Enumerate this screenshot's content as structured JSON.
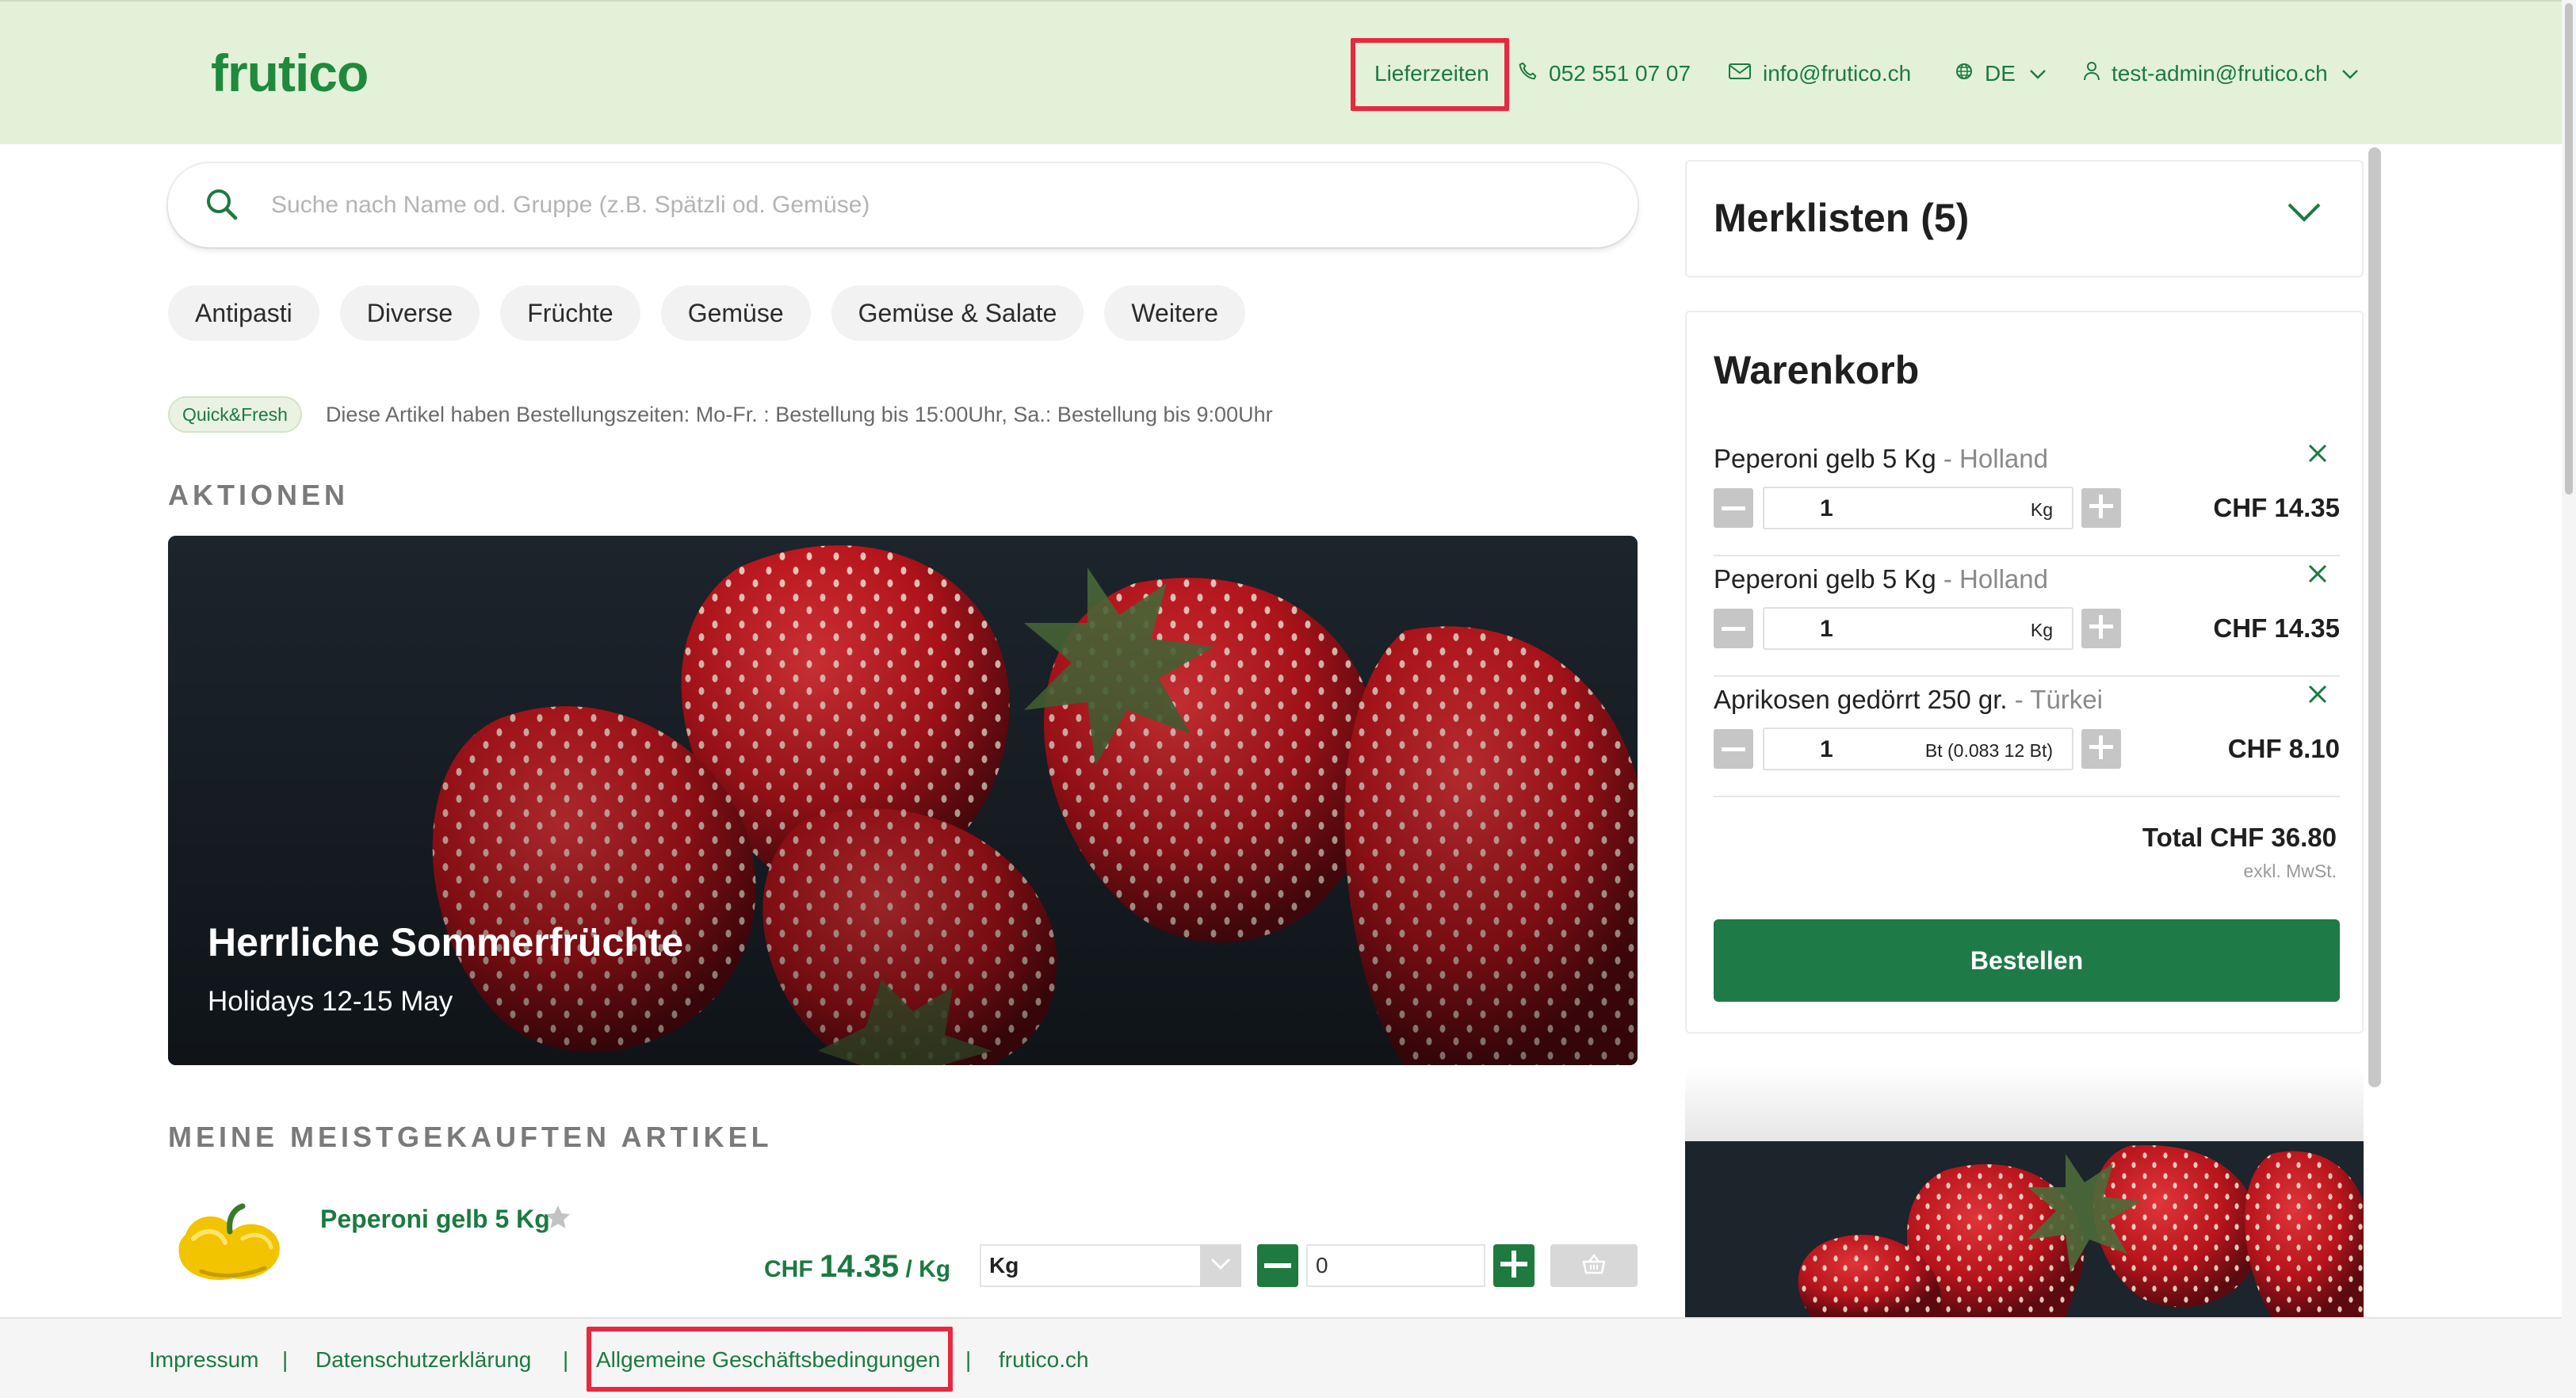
{
  "header": {
    "logo": "frutico",
    "delivery_times": "Lieferzeiten",
    "phone": "052 551 07 07",
    "email": "info@frutico.ch",
    "language": "DE",
    "user": "test-admin@frutico.ch",
    "bg_color": "#e3f1d8",
    "accent_color": "#1b7a40"
  },
  "search": {
    "placeholder": "Suche nach Name od. Gruppe (z.B. Spätzli od. Gemüse)"
  },
  "categories": [
    "Antipasti",
    "Diverse",
    "Früchte",
    "Gemüse",
    "Gemüse & Salate",
    "Weitere"
  ],
  "quickfresh": {
    "badge": "Quick&Fresh",
    "text": "Diese Artikel haben Bestellungszeiten: Mo-Fr. : Bestellung bis 15:00Uhr, Sa.: Bestellung bis 9:00Uhr"
  },
  "actions": {
    "heading": "AKTIONEN",
    "banner_title": "Herrliche Sommerfrüchte",
    "banner_subtitle": "Holidays 12-15 May"
  },
  "most_bought": {
    "heading": "MEINE MEISTGEKAUFTEN ARTIKEL",
    "product": {
      "name": "Peperoni gelb 5 Kg",
      "currency": "CHF",
      "price": "14.35",
      "per_unit": "/ Kg",
      "unit": "Kg",
      "quantity": "0"
    }
  },
  "watchlists": {
    "title": "Merklisten (5)"
  },
  "cart": {
    "title": "Warenkorb",
    "items": [
      {
        "name": "Peperoni gelb 5 Kg",
        "origin": "- Holland",
        "qty": "1",
        "unit": "Kg",
        "price": "CHF 14.35"
      },
      {
        "name": "Peperoni gelb 5 Kg",
        "origin": "- Holland",
        "qty": "1",
        "unit": "Kg",
        "price": "CHF 14.35"
      },
      {
        "name": "Aprikosen gedörrt 250 gr.",
        "origin": "- Türkei",
        "qty": "1",
        "unit": "Bt (0.083 12 Bt)",
        "price": "CHF 8.10"
      }
    ],
    "total": "Total CHF 36.80",
    "vat_note": "exkl. MwSt.",
    "order_button": "Bestellen"
  },
  "footer": {
    "links": [
      "Impressum",
      "Datenschutzerklärung",
      "Allgemeine Geschäftsbedingungen",
      "frutico.ch"
    ],
    "separator": "|"
  },
  "icons": [
    "search-icon",
    "phone-icon",
    "mail-icon",
    "globe-icon",
    "user-icon",
    "chevron-down-icon",
    "close-icon",
    "minus-icon",
    "plus-icon",
    "star-icon",
    "basket-icon"
  ],
  "highlight_color": "#e8283f"
}
